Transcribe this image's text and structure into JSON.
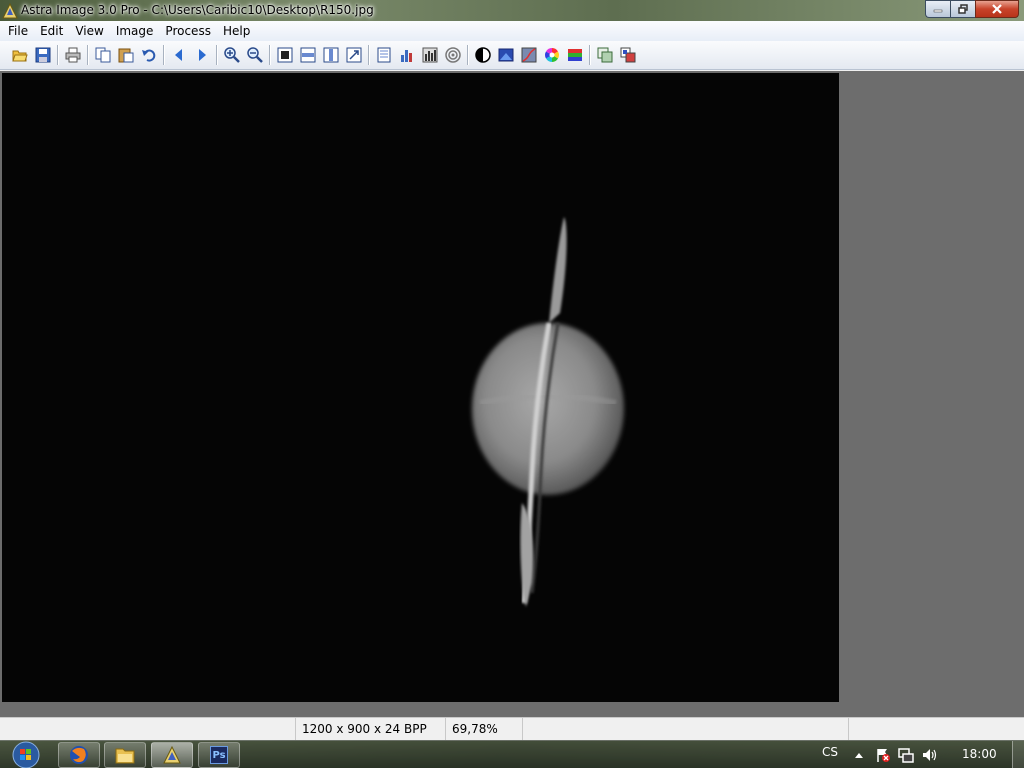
{
  "window": {
    "title": "Astra Image 3.0 Pro - C:\\Users\\Caribic10\\Desktop\\R150.jpg"
  },
  "menu": [
    "File",
    "Edit",
    "View",
    "Image",
    "Process",
    "Help"
  ],
  "toolbar": {
    "icons": [
      "open-folder-icon",
      "save-icon",
      "print-icon",
      "copy-icon",
      "paste-icon",
      "undo-icon",
      "back-arrow-icon",
      "forward-arrow-icon",
      "zoom-in-icon",
      "zoom-out-icon",
      "fit-icon",
      "fit-width-icon",
      "fit-height-icon",
      "actual-size-icon",
      "info-icon",
      "histogram-icon",
      "levels-icon",
      "target-icon",
      "contrast-icon",
      "color-balance-icon",
      "curves-icon",
      "color-wheel-icon",
      "rgb-channels-icon",
      "duplicate-icon",
      "compare-icon"
    ]
  },
  "statusbar": {
    "dimensions": "1200 x 900 x 24 BPP",
    "zoom": "69,78%"
  },
  "taskbar": {
    "apps": [
      "firefox-icon",
      "explorer-icon",
      "astra-image-icon",
      "photoshop-icon"
    ],
    "photoshop_label": "Ps",
    "language": "CS",
    "clock": "18:00"
  }
}
